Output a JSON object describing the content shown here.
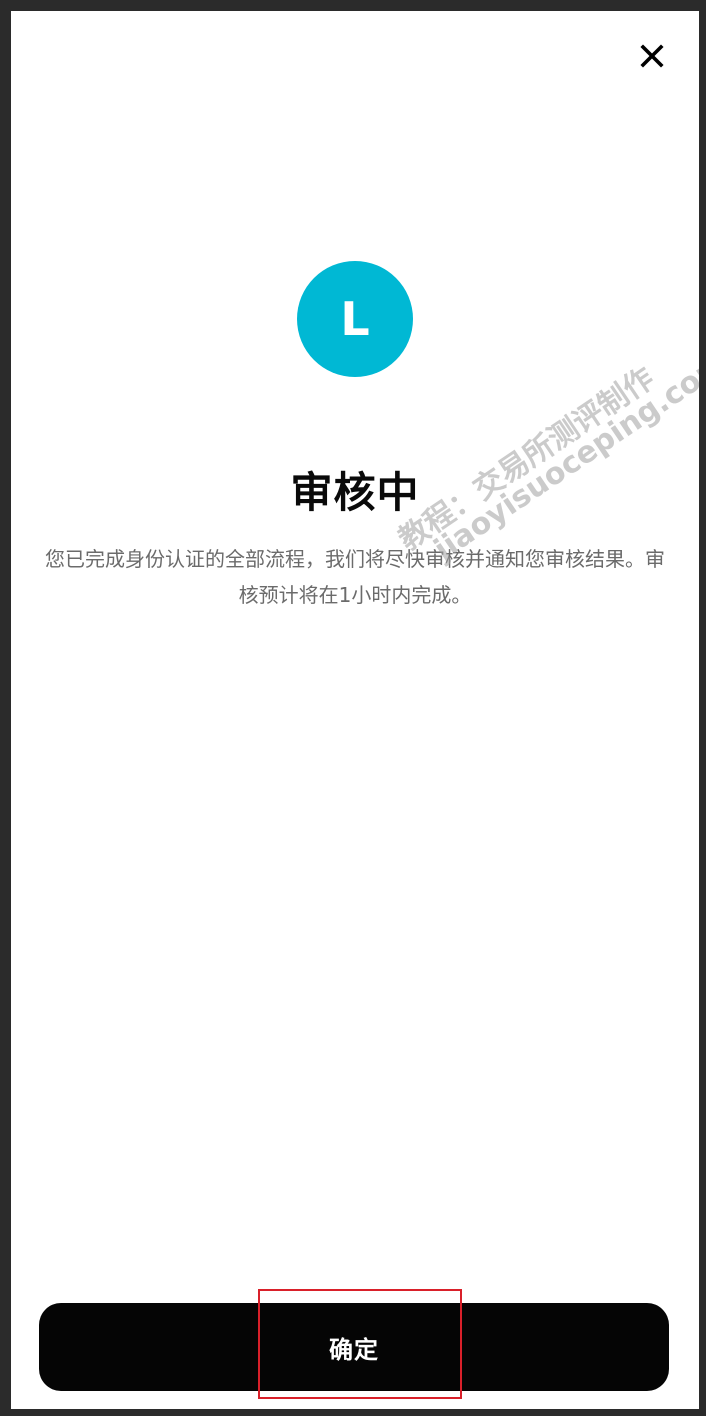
{
  "header": {
    "close_icon": "close-icon"
  },
  "avatar": {
    "letter": "L",
    "color": "#00b8d4"
  },
  "status": {
    "title": "审核中",
    "description": "您已完成身份认证的全部流程，我们将尽快审核并通知您审核结果。审核预计将在1小时内完成。"
  },
  "footer": {
    "confirm_label": "确定",
    "button_color": "#050505",
    "highlight_color": "#d9202a"
  },
  "watermark": {
    "line1": "教程：交易所测评制作",
    "line2": "jiaoyisuoceping.com"
  }
}
